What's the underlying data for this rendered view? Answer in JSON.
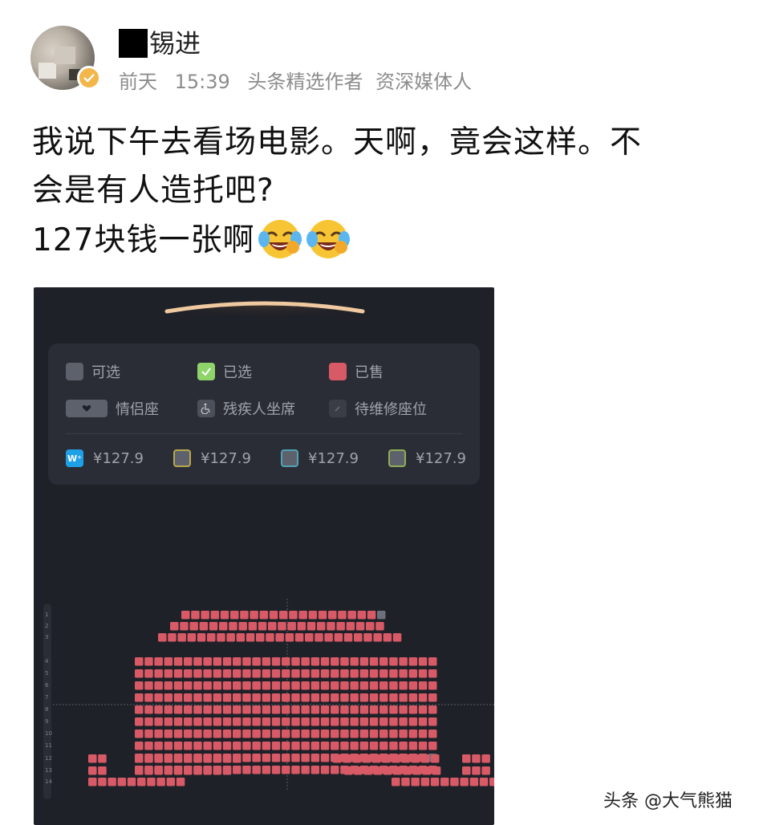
{
  "author": {
    "name_suffix": "锡进",
    "time_day": "前天",
    "time_clock": "15:39",
    "badge_1": "头条精选作者",
    "badge_2": "资深媒体人"
  },
  "post": {
    "line1": "我说下午去看场电影。天啊，竟会这样。不",
    "line2": "会是有人造托吧?",
    "line3": "127块钱一张啊"
  },
  "seatmap": {
    "legend": {
      "available": "可选",
      "selected": "已选",
      "sold": "已售",
      "couple": "情侣座",
      "disabled": "残疾人坐席",
      "repair": "待维修座位"
    },
    "prices": [
      {
        "label": "¥127.9",
        "border": "#1ea0e6",
        "badge": "W⁺"
      },
      {
        "label": "¥127.9",
        "border": "#b8a84a"
      },
      {
        "label": "¥127.9",
        "border": "#4fa3b5"
      },
      {
        "label": "¥127.9",
        "border": "#8fae58"
      }
    ],
    "row_numbers": [
      "1",
      "2",
      "3",
      "4",
      "5",
      "6",
      "7",
      "8",
      "9",
      "10",
      "11",
      "12",
      "13",
      "14"
    ],
    "colors": {
      "background": "#1f2128",
      "sold": "#d85a66",
      "available": "#6c707a",
      "screen": "#f0c9a0"
    }
  },
  "watermark": "头条 @大气熊猫"
}
